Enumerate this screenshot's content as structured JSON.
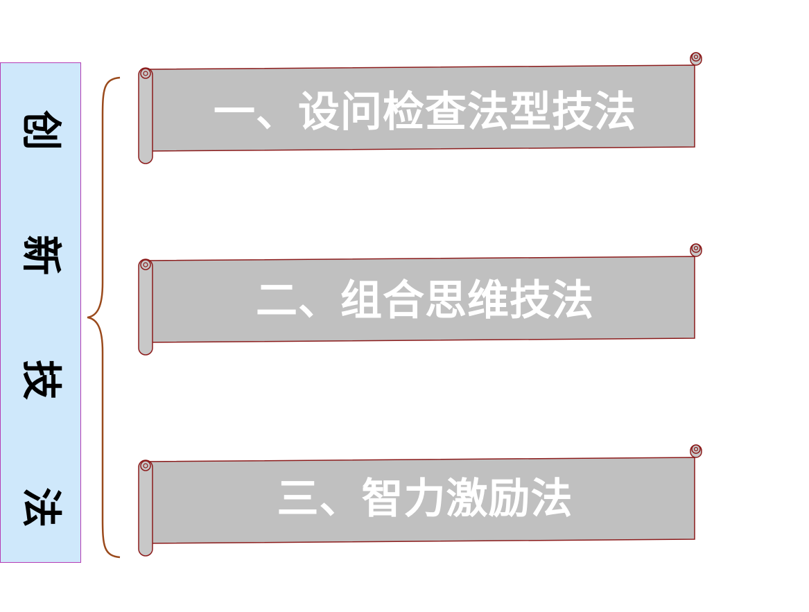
{
  "side_title": {
    "chars": [
      "创",
      "新",
      "技",
      "法"
    ]
  },
  "items": [
    {
      "label": "一、设问检查法型技法"
    },
    {
      "label": "二、组合思维技法"
    },
    {
      "label": "三、智力激励法"
    }
  ],
  "colors": {
    "side_fill": "#cfe8fb",
    "side_border": "#b43bb4",
    "brace": "#9a4a1c",
    "scroll_fill": "#c0c0c0",
    "scroll_border": "#8b1a1a",
    "scroll_text": "#ffffff"
  }
}
